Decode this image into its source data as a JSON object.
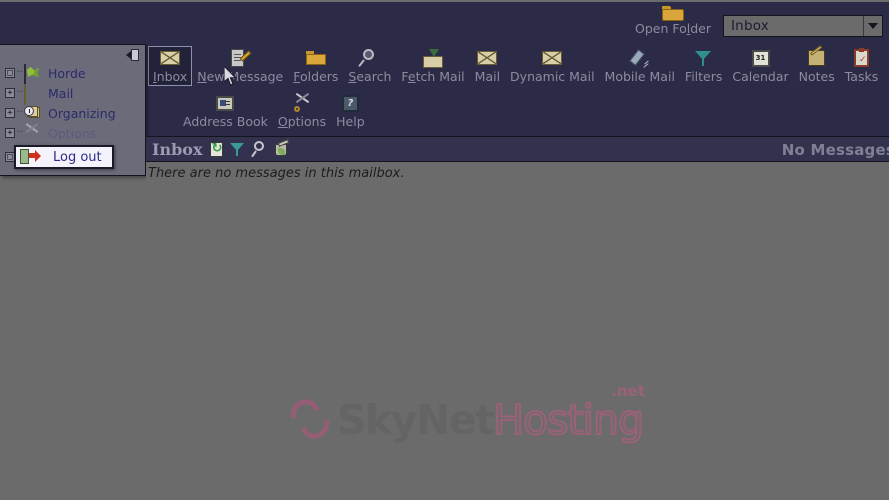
{
  "app": {
    "background_color": "#6b6b6b",
    "banner_color": "#2b2b47",
    "accent_color": "#c25a86"
  },
  "topbar": {
    "open_folder": {
      "label_pre": "Open Fo",
      "label_accel": "l",
      "label_post": "der",
      "icon": "folder-icon"
    },
    "folder_select": {
      "value": "Inbox",
      "options": [
        "Inbox"
      ]
    }
  },
  "toolbar": {
    "row1": [
      {
        "label_pre": "",
        "accel": "I",
        "label_post": "nbox",
        "icon": "envelope-icon",
        "selected": true,
        "name": "inbox"
      },
      {
        "label_pre": "",
        "accel": "N",
        "label_post": "ew Message",
        "icon": "compose-icon",
        "selected": false,
        "name": "new-message"
      },
      {
        "label_pre": "",
        "accel": "F",
        "label_post": "olders",
        "icon": "folder-icon",
        "selected": false,
        "name": "folders"
      },
      {
        "label_pre": "",
        "accel": "S",
        "label_post": "earch",
        "icon": "magnifier-icon",
        "selected": false,
        "name": "search"
      },
      {
        "label_pre": "F",
        "accel": "e",
        "label_post": "tch Mail",
        "icon": "fetch-mail-icon",
        "selected": false,
        "name": "fetch-mail"
      },
      {
        "label_pre": "Mail",
        "accel": "",
        "label_post": "",
        "icon": "envelope-icon",
        "selected": false,
        "name": "mail"
      },
      {
        "label_pre": "Dynamic Mail",
        "accel": "",
        "label_post": "",
        "icon": "envelope-icon",
        "selected": false,
        "name": "dynamic-mail"
      },
      {
        "label_pre": "Mobile Mail",
        "accel": "",
        "label_post": "",
        "icon": "mobile-phone-icon",
        "selected": false,
        "name": "mobile-mail"
      },
      {
        "label_pre": "Filters",
        "accel": "",
        "label_post": "",
        "icon": "funnel-icon",
        "selected": false,
        "name": "filters"
      },
      {
        "label_pre": "Calendar",
        "accel": "",
        "label_post": "",
        "icon": "calendar-icon",
        "icon_text": "31",
        "selected": false,
        "name": "calendar"
      },
      {
        "label_pre": "Notes",
        "accel": "",
        "label_post": "",
        "icon": "notes-icon",
        "selected": false,
        "name": "notes"
      },
      {
        "label_pre": "Tasks",
        "accel": "",
        "label_post": "",
        "icon": "tasks-icon",
        "selected": false,
        "name": "tasks"
      }
    ],
    "row2": [
      {
        "label_pre": "Address Book",
        "accel": "",
        "label_post": "",
        "icon": "address-book-icon",
        "name": "address-book"
      },
      {
        "label_pre": "",
        "accel": "O",
        "label_post": "ptions",
        "icon": "tools-icon",
        "name": "options"
      },
      {
        "label_pre": "Help",
        "accel": "",
        "label_post": "",
        "icon": "help-icon",
        "name": "help"
      }
    ]
  },
  "sidebar": {
    "collapse_icon": "collapse-sidebar-icon",
    "items": [
      {
        "label": "Horde",
        "expander": "□",
        "icon": "horde-icon",
        "dim": false,
        "highlighted": false
      },
      {
        "label": "Mail",
        "expander": "+",
        "icon": "envelope-icon",
        "dim": false,
        "highlighted": false
      },
      {
        "label": "Organizing",
        "expander": "+",
        "icon": "organizing-icon",
        "dim": false,
        "highlighted": false
      },
      {
        "label": "Options",
        "expander": "+",
        "icon": "tools-icon",
        "dim": true,
        "highlighted": false
      },
      {
        "label": "Log out",
        "expander": "□",
        "icon": "logout-icon",
        "dim": false,
        "highlighted": true
      }
    ]
  },
  "content": {
    "header": {
      "title": "Inbox",
      "icons": [
        {
          "name": "refresh-icon"
        },
        {
          "name": "filter-icon"
        },
        {
          "name": "search-icon"
        },
        {
          "name": "empty-trash-icon"
        }
      ],
      "status": "No Messages"
    },
    "empty_text": "There are no messages in this mailbox."
  },
  "watermark": {
    "part1": "SkyNet",
    "part2": "Hosting",
    "part3": ".net"
  }
}
